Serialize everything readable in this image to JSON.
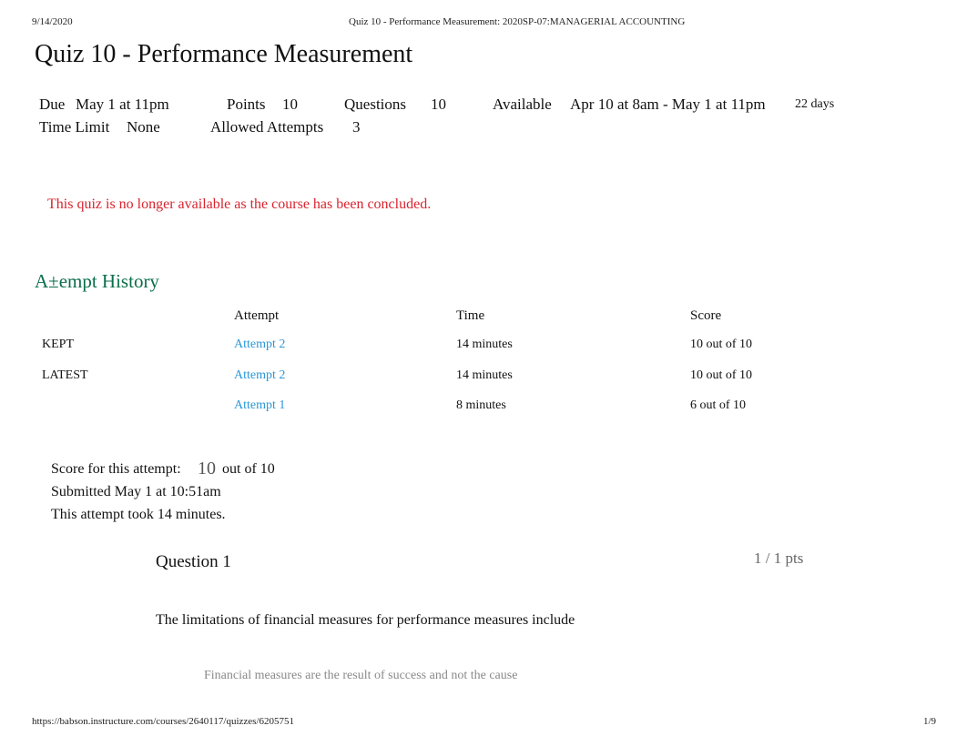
{
  "print_header": {
    "date": "9/14/2020",
    "doc_title": "Quiz 10 - Performance Measurement: 2020SP-07:MANAGERIAL ACCOUNTING"
  },
  "quiz": {
    "title": "Quiz 10 - Performance Measurement",
    "details": {
      "due_label": "Due",
      "due_value": "May 1 at 11pm",
      "points_label": "Points",
      "points_value": "10",
      "questions_label": "Questions",
      "questions_value": "10",
      "available_label": "Available",
      "available_value": "Apr 10 at 8am - May 1 at 11pm",
      "available_duration": "22 days",
      "time_limit_label": "Time Limit",
      "time_limit_value": "None",
      "allowed_attempts_label": "Allowed Attempts",
      "allowed_attempts_value": "3"
    },
    "notice": "This quiz is no longer available as the course has been concluded."
  },
  "attempt_history": {
    "heading": "A±empt History",
    "columns": [
      "",
      "Attempt",
      "Time",
      "Score"
    ],
    "rows": [
      {
        "tag": "KEPT",
        "attempt": "Attempt 2",
        "time": "14 minutes",
        "score": "10 out of 10"
      },
      {
        "tag": "LATEST",
        "attempt": "Attempt 2",
        "time": "14 minutes",
        "score": "10 out of 10"
      },
      {
        "tag": "",
        "attempt": "Attempt 1",
        "time": "8 minutes",
        "score": "6 out of 10"
      }
    ]
  },
  "attempt_summary": {
    "score_label": "Score for this attempt:",
    "score_value": "10",
    "score_suffix": "out of 10",
    "submitted": "Submitted May 1 at 10:51am",
    "duration": "This attempt took 14 minutes."
  },
  "questions": [
    {
      "title": "Question 1",
      "points": "1 / 1 pts",
      "text": "The limitations of financial measures for performance measures include",
      "answers": [
        "Financial measures are the result of success and not the cause"
      ]
    }
  ],
  "print_footer": {
    "url": "https://babson.instructure.com/courses/2640117/quizzes/6205751",
    "page": "1/9"
  }
}
